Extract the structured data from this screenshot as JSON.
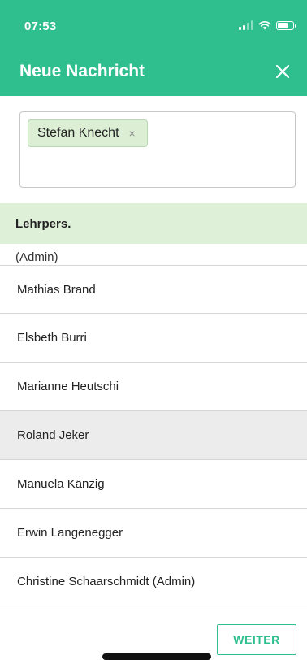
{
  "status_bar": {
    "time": "07:53",
    "icons": [
      "signal-icon",
      "wifi-icon",
      "battery-icon"
    ]
  },
  "header": {
    "title": "Neue Nachricht",
    "close_icon": "close-icon"
  },
  "recipients": {
    "chips": [
      {
        "label": "Stefan Knecht",
        "remove_symbol": "×"
      }
    ]
  },
  "group": {
    "label": "Lehrpers.",
    "partial_item": "(Admin)"
  },
  "list": {
    "items": [
      {
        "label": "Mathias Brand",
        "selected": false
      },
      {
        "label": "Elsbeth Burri",
        "selected": false
      },
      {
        "label": "Marianne Heutschi",
        "selected": false
      },
      {
        "label": "Roland Jeker",
        "selected": true
      },
      {
        "label": "Manuela Känzig",
        "selected": false
      },
      {
        "label": "Erwin Langenegger",
        "selected": false
      },
      {
        "label": "Christine Schaarschmidt (Admin)",
        "selected": false
      }
    ]
  },
  "footer": {
    "next_label": "WEITER"
  },
  "colors": {
    "accent": "#2fbf8f",
    "chip_bg": "#dcefd5",
    "group_bg": "#dff0d8",
    "selected_bg": "#ececec"
  }
}
